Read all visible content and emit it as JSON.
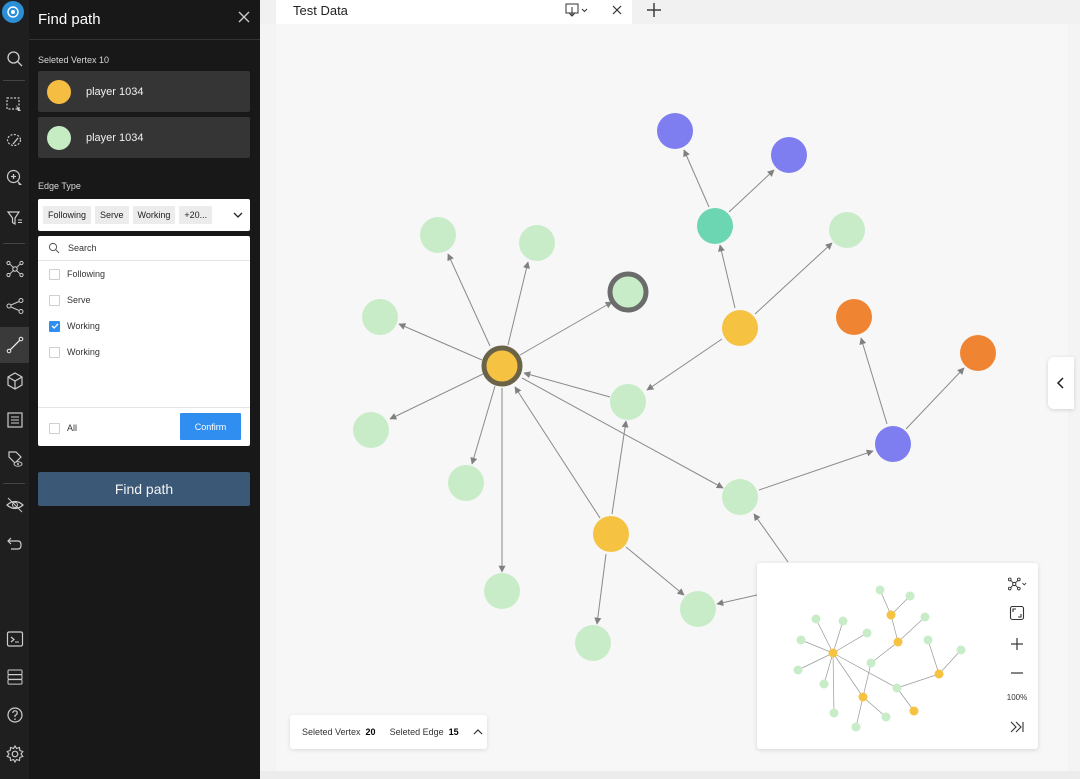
{
  "panel": {
    "title": "Find path",
    "selected_vertex_label": "Seleted Vertex 10",
    "vertices": [
      {
        "name": "player 1034",
        "color": "#f5bd41"
      },
      {
        "name": "player 1034",
        "color": "#c6ecc4"
      }
    ],
    "edge_type_label": "Edge Type",
    "selected_tags": [
      "Following",
      "Serve",
      "Working",
      "+20..."
    ],
    "dropdown": {
      "search_placeholder": "Search",
      "options": [
        {
          "label": "Following",
          "checked": false
        },
        {
          "label": "Serve",
          "checked": false
        },
        {
          "label": "Working",
          "checked": true
        },
        {
          "label": "Working",
          "checked": false
        }
      ],
      "all_label": "All",
      "confirm_label": "Confirm"
    },
    "find_path_button": "Find path"
  },
  "tabs": [
    {
      "title": "Test Data"
    }
  ],
  "status": {
    "vertex_label": "Seleted Vertex",
    "vertex_count": "20",
    "edge_label": "Seleted Edge",
    "edge_count": "15"
  },
  "minimap": {
    "zoom": "100%"
  },
  "colors": {
    "player_yellow": "#f5c242",
    "light_green": "#c8ecc8",
    "teal": "#6cd5b2",
    "purple": "#7e7ef0",
    "orange": "#ef8533",
    "accent_blue": "#2f8ef0",
    "find_path_btn": "#3b5877"
  },
  "toolbar_icons": [
    "logo-icon",
    "search-icon",
    "rect-select-icon",
    "lasso-select-icon",
    "zoom-select-icon",
    "filter-icon",
    "graph-layout-icon",
    "share-icon",
    "path-icon",
    "cube-icon",
    "list-icon",
    "tag-eye-icon",
    "visibility-icon",
    "undo-icon",
    "terminal-icon",
    "database-icon",
    "help-icon",
    "settings-icon"
  ]
}
